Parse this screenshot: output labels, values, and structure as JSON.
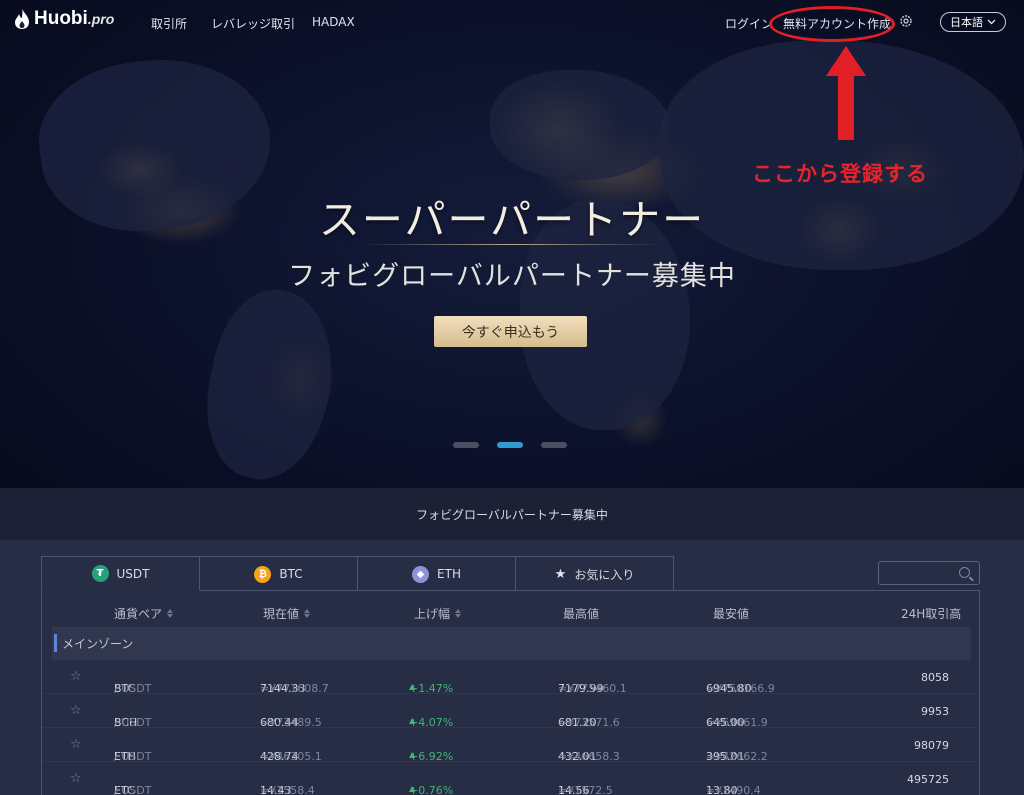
{
  "nav": {
    "logo_text": "Huobi",
    "logo_suffix": ".pro",
    "links": [
      "取引所",
      "レバレッジ取引",
      "HADAX"
    ],
    "login": "ログイン",
    "signup": "無料アカウント作成",
    "language": "日本語"
  },
  "annotation": {
    "text": "ここから登録する",
    "color": "#e31f26"
  },
  "hero": {
    "title": "スーパーパートナー",
    "subtitle": "フォビグローバルパートナー募集中",
    "cta": "今すぐ申込もう",
    "carousel_active_index": 1,
    "carousel_count": 3
  },
  "banner": {
    "text": "フォビグローバルパートナー募集中"
  },
  "market": {
    "tabs": [
      {
        "label": "USDT",
        "icon": "tether-icon",
        "color": "#26a17b"
      },
      {
        "label": "BTC",
        "icon": "bitcoin-icon",
        "color": "#f7a21a"
      },
      {
        "label": "ETH",
        "icon": "ethereum-icon",
        "color": "#8c93d6"
      },
      {
        "label": "お気に入り",
        "icon": "star-icon"
      }
    ],
    "columns": {
      "pair": "通貨ペア",
      "price": "現在値",
      "change": "上げ幅",
      "high": "最高値",
      "low": "最安値",
      "volume": "24H取引高"
    },
    "zone": "メインゾーン",
    "rows": [
      {
        "base": "BTC",
        "quote": "/ USDT",
        "price": "7144.33",
        "price_cny": "≈¥771608.7",
        "change": "+1.47%",
        "high": "7179.99",
        "high_cny": "≈¥775460.1",
        "low": "6945.80",
        "low_cny": "≈¥750166.9",
        "volume": "8058"
      },
      {
        "base": "BCH",
        "quote": "/ USDT",
        "price": "680.44",
        "price_cny": "≈¥73489.5",
        "change": "+4.07%",
        "high": "681.20",
        "high_cny": "≈¥73571.6",
        "low": "645.00",
        "low_cny": "≈¥69661.9",
        "volume": "9953"
      },
      {
        "base": "ETH",
        "quote": "/ USDT",
        "price": "428.74",
        "price_cny": "≈¥46305.1",
        "change": "+6.92%",
        "high": "432.01",
        "high_cny": "≈¥46658.3",
        "low": "395.01",
        "low_cny": "≈¥42662.2",
        "volume": "98079"
      },
      {
        "base": "ETC",
        "quote": "/ USDT",
        "price": "14.43",
        "price_cny": "≈¥1558.4",
        "change": "+0.76%",
        "high": "14.56",
        "high_cny": "≈¥1572.5",
        "low": "13.80",
        "low_cny": "≈¥1490.4",
        "volume": "495725"
      }
    ]
  }
}
